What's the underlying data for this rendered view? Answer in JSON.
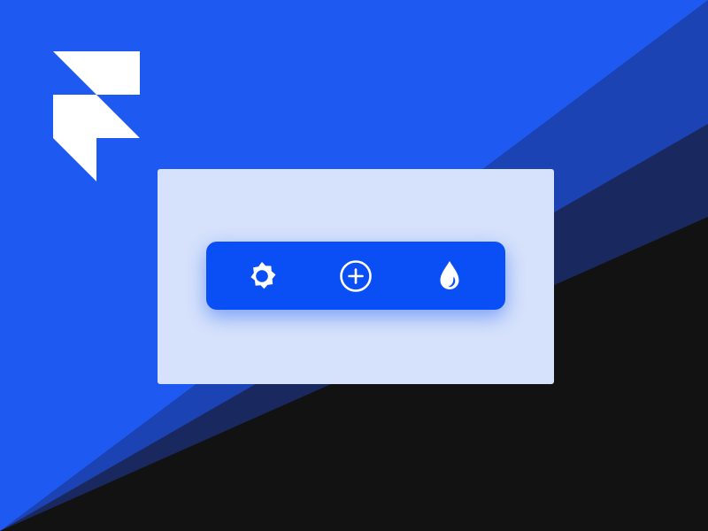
{
  "colors": {
    "background_blue": "#1E5AF2",
    "stripe_mid_blue": "#1C43B4",
    "stripe_navy": "#19295F",
    "background_black": "#121212",
    "logo": "#FFFFFF",
    "card": "#D6E2FB",
    "toolbar": "#0A4FF6",
    "toolbar_glow": "rgba(10, 79, 246, 0.45)",
    "icon": "#FFFFFF"
  },
  "logo": {
    "name": "framer-logo"
  },
  "toolbar": {
    "buttons": [
      {
        "icon": "gear-icon",
        "label": ""
      },
      {
        "icon": "plus-circle-icon",
        "label": ""
      },
      {
        "icon": "droplet-icon",
        "label": ""
      }
    ]
  }
}
